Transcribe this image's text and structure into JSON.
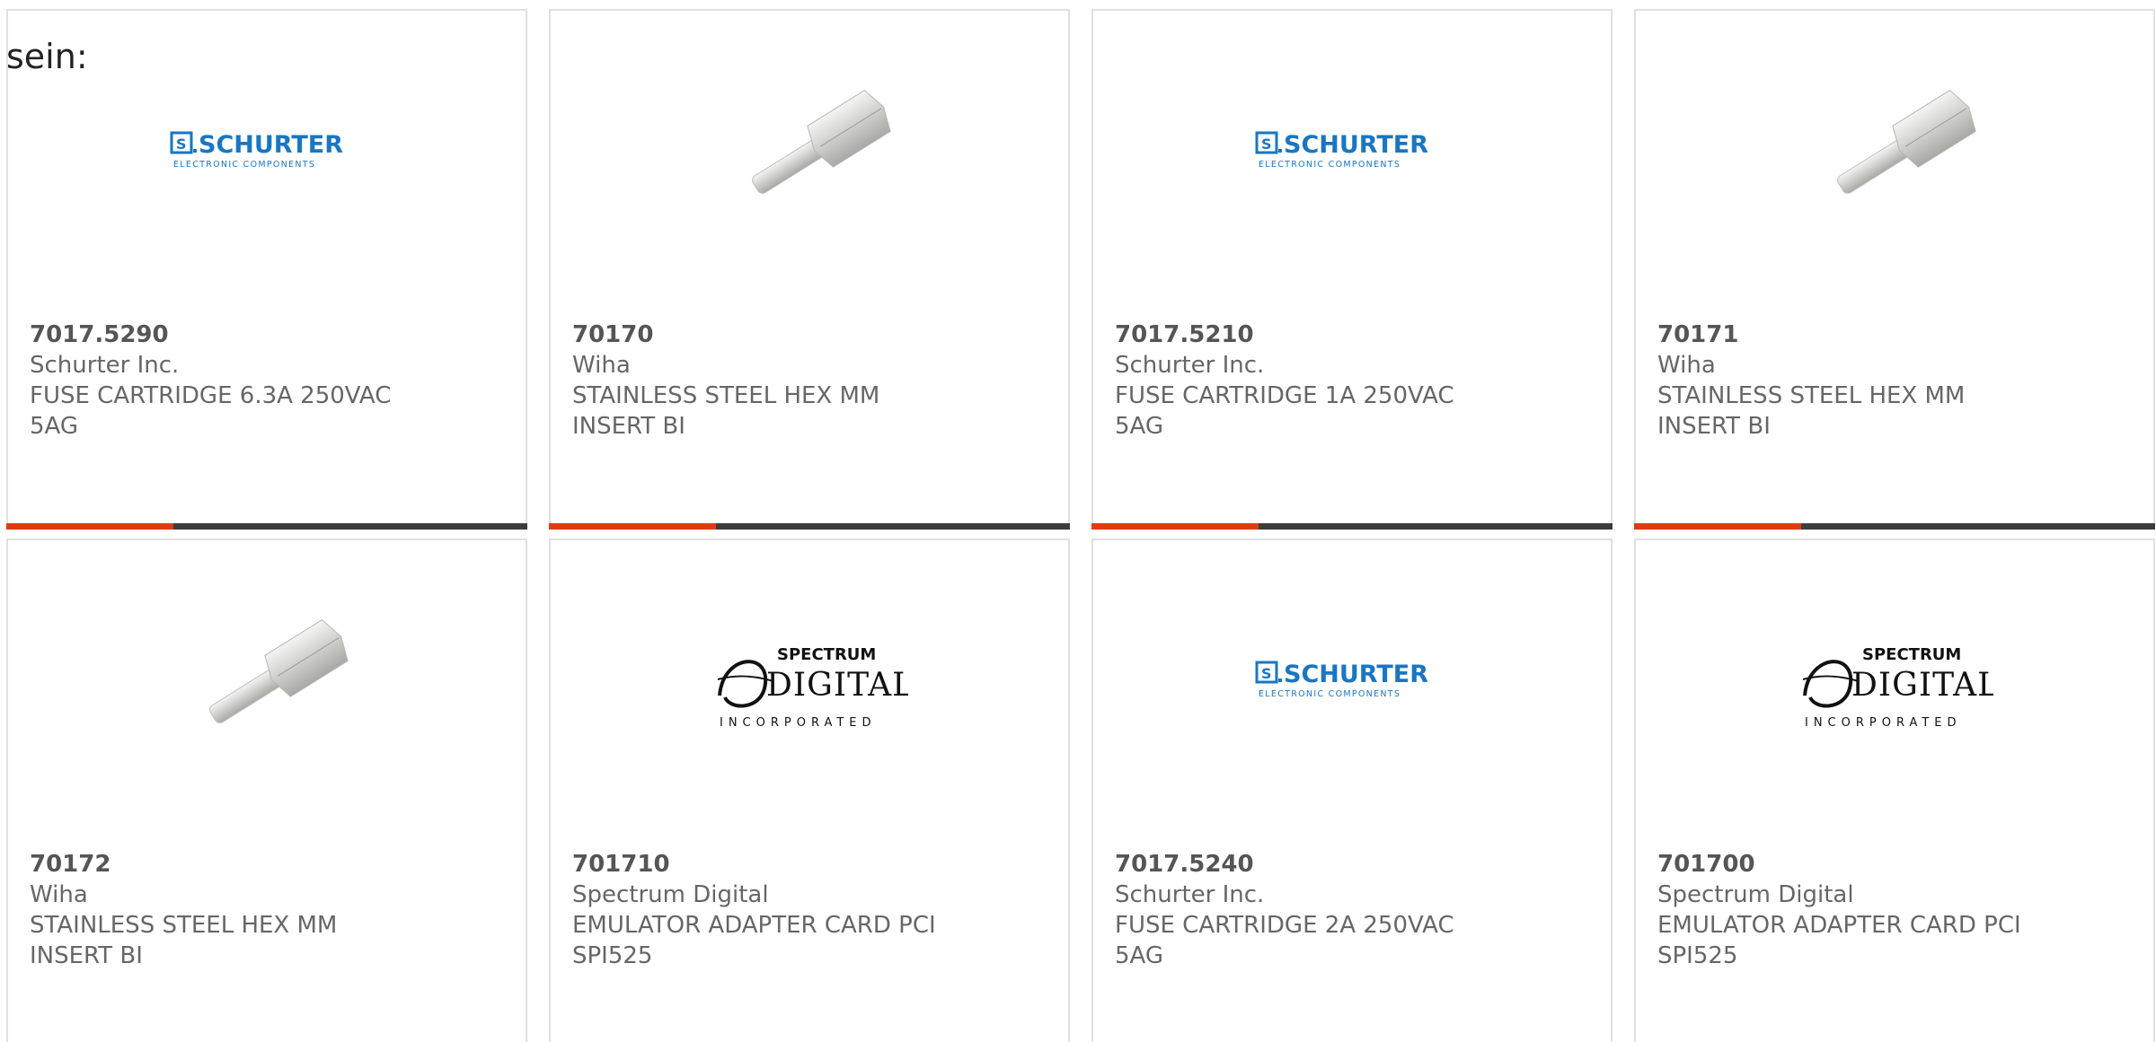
{
  "intro": {
    "text": "sein:"
  },
  "colors": {
    "accent": "#e03a13",
    "bar": "#3c3c3c",
    "schurter_blue": "#1a76c2",
    "border": "#e0e0e0"
  },
  "products": [
    {
      "part_number": "7017.5290",
      "manufacturer": "Schurter Inc.",
      "description": "FUSE CARTRIDGE 6.3A 250VAC\n5AG",
      "logo": "schurter-logo",
      "logo_text": "SCHURTER",
      "logo_subtext": "ELECTRONIC COMPONENTS",
      "progress": 0.32
    },
    {
      "part_number": "70170",
      "manufacturer": "Wiha",
      "description": "STAINLESS STEEL HEX MM\nINSERT BI",
      "logo": "hex-bit-image",
      "progress": 0.32
    },
    {
      "part_number": "7017.5210",
      "manufacturer": "Schurter Inc.",
      "description": "FUSE CARTRIDGE 1A 250VAC\n5AG",
      "logo": "schurter-logo",
      "logo_text": "SCHURTER",
      "logo_subtext": "ELECTRONIC COMPONENTS",
      "progress": 0.32
    },
    {
      "part_number": "70171",
      "manufacturer": "Wiha",
      "description": "STAINLESS STEEL HEX MM\nINSERT BI",
      "logo": "hex-bit-image",
      "progress": 0.32
    },
    {
      "part_number": "70172",
      "manufacturer": "Wiha",
      "description": "STAINLESS STEEL HEX MM\nINSERT BI",
      "logo": "hex-bit-image"
    },
    {
      "part_number": "701710",
      "manufacturer": "Spectrum Digital",
      "description": "EMULATOR ADAPTER CARD PCI\nSPI525",
      "logo": "spectrum-digital-logo",
      "logo_text": "SPECTRUM",
      "logo_main": "DIGITAL",
      "logo_subtext": "INCORPORATED"
    },
    {
      "part_number": "7017.5240",
      "manufacturer": "Schurter Inc.",
      "description": "FUSE CARTRIDGE 2A 250VAC\n5AG",
      "logo": "schurter-logo",
      "logo_text": "SCHURTER",
      "logo_subtext": "ELECTRONIC COMPONENTS"
    },
    {
      "part_number": "701700",
      "manufacturer": "Spectrum Digital",
      "description": "EMULATOR ADAPTER CARD PCI\nSPI525",
      "logo": "spectrum-digital-logo",
      "logo_text": "SPECTRUM",
      "logo_main": "DIGITAL",
      "logo_subtext": "INCORPORATED"
    }
  ]
}
